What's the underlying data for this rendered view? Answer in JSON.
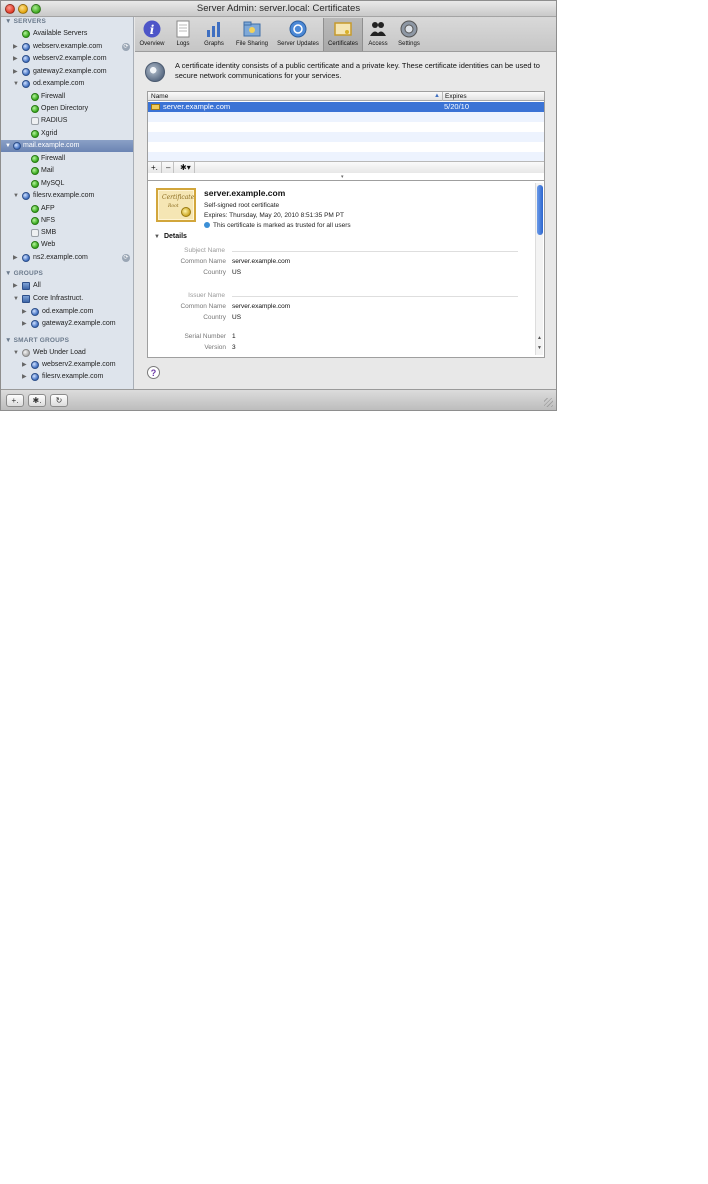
{
  "window": {
    "title": "Server Admin: server.local: Certificates"
  },
  "sidebar": {
    "servers_heading": "SERVERS",
    "groups_heading": "GROUPS",
    "smart_groups_heading": "SMART GROUPS",
    "servers": [
      {
        "label": "Available Servers"
      },
      {
        "label": "webserv.example.com"
      },
      {
        "label": "webserv2.example.com"
      },
      {
        "label": "gateway2.example.com"
      },
      {
        "label": "od.example.com"
      },
      {
        "label": "Firewall"
      },
      {
        "label": "Open Directory"
      },
      {
        "label": "RADIUS"
      },
      {
        "label": "Xgrid"
      },
      {
        "label": "mail.example.com"
      },
      {
        "label": "Firewall"
      },
      {
        "label": "Mail"
      },
      {
        "label": "MySQL"
      },
      {
        "label": "filesrv.example.com"
      },
      {
        "label": "AFP"
      },
      {
        "label": "NFS"
      },
      {
        "label": "SMB"
      },
      {
        "label": "Web"
      },
      {
        "label": "ns2.example.com"
      }
    ],
    "groups": [
      {
        "label": "All"
      },
      {
        "label": "Core Infrastruct."
      },
      {
        "label": "od.example.com"
      },
      {
        "label": "gateway2.example.com"
      }
    ],
    "smart_groups": [
      {
        "label": "Web Under Load"
      },
      {
        "label": "webserv2.example.com"
      },
      {
        "label": "filesrv.example.com"
      }
    ]
  },
  "toolbar": {
    "items": [
      {
        "label": "Overview",
        "icon": "info-icon"
      },
      {
        "label": "Logs",
        "icon": "logs-icon"
      },
      {
        "label": "Graphs",
        "icon": "graphs-icon"
      },
      {
        "label": "File Sharing",
        "icon": "file-sharing-icon"
      },
      {
        "label": "Server Updates",
        "icon": "server-updates-icon"
      },
      {
        "label": "Certificates",
        "icon": "certificates-icon"
      },
      {
        "label": "Access",
        "icon": "access-icon"
      },
      {
        "label": "Settings",
        "icon": "settings-icon"
      }
    ],
    "active": "Certificates"
  },
  "main": {
    "description": "A certificate identity consists of a public certificate and a private key. These certificate identities can be used to secure network communications for your services.",
    "table": {
      "col_name": "Name",
      "col_expires": "Expires",
      "rows": [
        {
          "name": "server.example.com",
          "expires": "5/20/10"
        }
      ],
      "footer_add": "+.",
      "footer_remove": "–",
      "footer_action": "✱▾"
    },
    "detail": {
      "title": "server.example.com",
      "subtitle": "Self-signed root certificate",
      "expires": "Expires: Thursday, May 20, 2010 8:51:35 PM PT",
      "trust": "This certificate is marked as trusted for all users",
      "cert_image_text": "Certificate",
      "cert_image_text2": "Root",
      "details_label": "Details",
      "subject_heading": "Subject Name",
      "subject_common_name_key": "Common Name",
      "subject_common_name": "server.example.com",
      "subject_country_key": "Country",
      "subject_country": "US",
      "issuer_heading": "Issuer Name",
      "issuer_common_name_key": "Common Name",
      "issuer_common_name": "server.example.com",
      "issuer_country_key": "Country",
      "issuer_country": "US",
      "serial_key": "Serial Number",
      "serial": "1",
      "version_key": "Version",
      "version": "3"
    },
    "help": "?"
  },
  "bottombar": {
    "add": "+.",
    "action": "✱.",
    "refresh": "↻"
  },
  "colors": {
    "selection": "#3b73d5",
    "sidebar": "#dee4ec",
    "sidebar_selection": "#7891bd"
  }
}
